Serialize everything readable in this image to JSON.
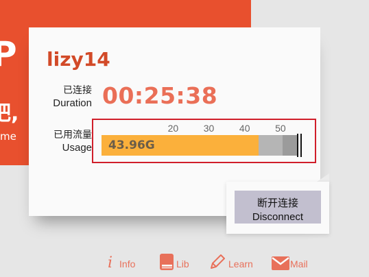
{
  "background": {
    "glyph_1": "P",
    "glyph_2": "吧,",
    "glyph_3": "me"
  },
  "account": {
    "username": "lizy14"
  },
  "duration": {
    "label_cn": "已连接",
    "label_en": "Duration",
    "value": "00:25:38"
  },
  "usage": {
    "label_cn": "已用流量",
    "label_en": "Usage",
    "value_text": "43.96G",
    "value_gb": 43.96,
    "light_segment_end_gb": 50.5,
    "scale_min_gb": 0,
    "scale_max_gb": 55,
    "ticks": [
      "20",
      "30",
      "40",
      "50"
    ],
    "used_color": "#fbb03b"
  },
  "disconnect": {
    "label_cn": "断开连接",
    "label_en": "Disconnect"
  },
  "nav": {
    "info": "Info",
    "lib": "Lib",
    "learn": "Learn",
    "mail": "Mail"
  },
  "colors": {
    "accent": "#e8502e",
    "username": "#d24a28",
    "duration": "#ea6f57",
    "highlight_border": "#d01e2a"
  }
}
